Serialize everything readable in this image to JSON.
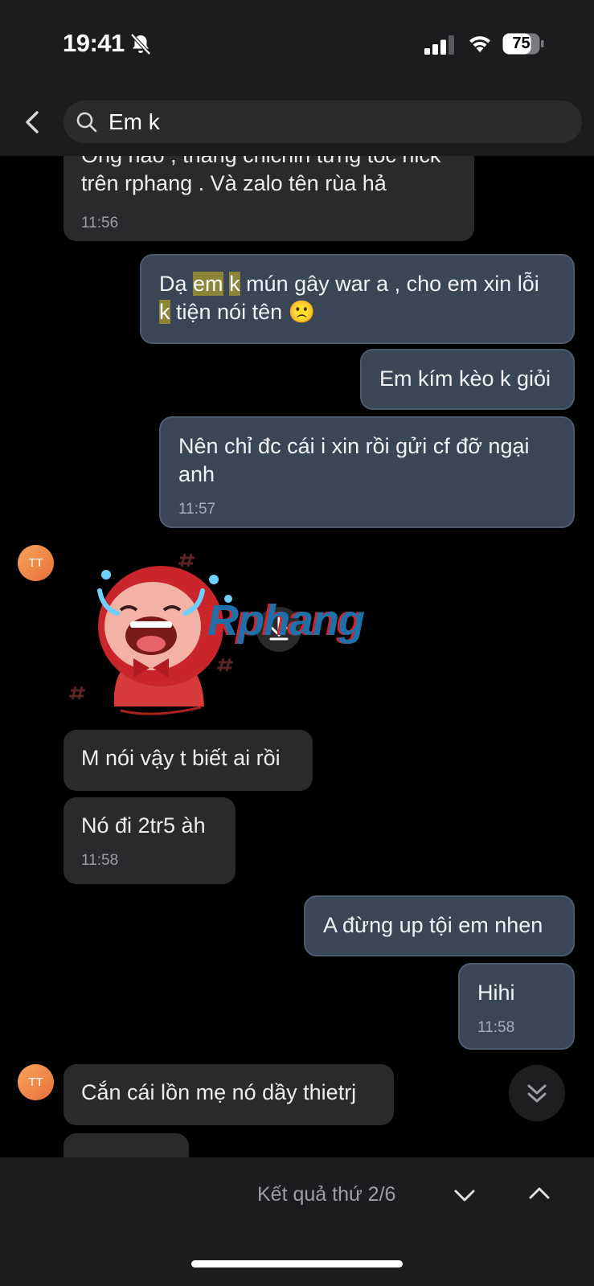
{
  "status_bar": {
    "time": "19:41",
    "battery": "75"
  },
  "search": {
    "query": "Em k"
  },
  "messages": [
    {
      "sender": "them",
      "text": "Ông nào , thằng chichin từng tóc nick trên rphang . Và zalo tên rùa hả",
      "time": "11:56"
    },
    {
      "sender": "me",
      "parts": [
        "Dạ ",
        "em",
        " ",
        "k",
        " mún gây war a , cho em xin lỗi ",
        "k",
        " tiện nói tên "
      ],
      "emoji": "🙁"
    },
    {
      "sender": "me",
      "text": "Em kím kèo k giỏi"
    },
    {
      "sender": "me",
      "text": "Nên chỉ đc cái i xin rồi gửi cf đỡ ngại anh",
      "time": "11:57"
    },
    {
      "sender": "them",
      "type": "sticker",
      "avatar": "TT",
      "watermark": "Rphang"
    },
    {
      "sender": "them",
      "text": "M nói vậy t biết ai rồi"
    },
    {
      "sender": "them",
      "text": "Nó đi 2tr5 àh",
      "time": "11:58"
    },
    {
      "sender": "me",
      "text": "A đừng up tội em nhen"
    },
    {
      "sender": "me",
      "text": "Hihi",
      "time": "11:58"
    },
    {
      "sender": "them",
      "avatar": "TT",
      "text": "Cắn cái lồn mẹ nó dầy thietrj"
    }
  ],
  "bottom_bar": {
    "result_label": "Kết quả thứ 2/6"
  },
  "colors": {
    "incoming_bubble": "#2a2a2c",
    "outgoing_bubble": "#3a4656",
    "highlight": "#8c8436",
    "avatar": "#f08a4b"
  }
}
